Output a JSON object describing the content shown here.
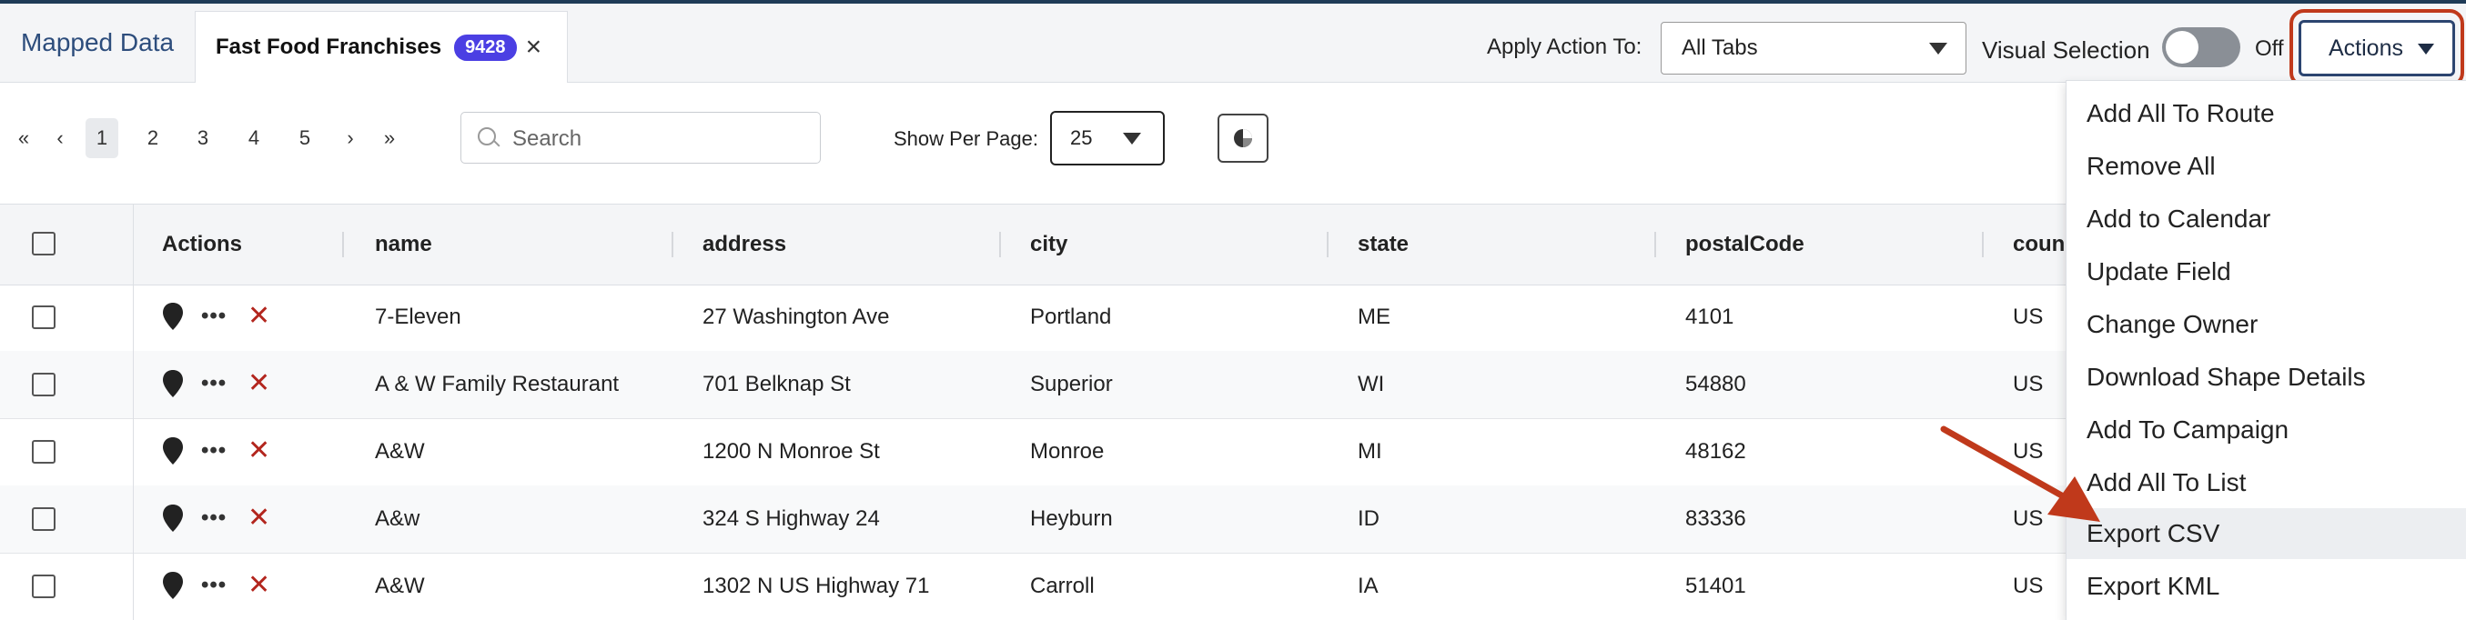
{
  "tabs": {
    "mapped_label": "Mapped Data",
    "active": {
      "label": "Fast Food Franchises",
      "count": "9428",
      "close": "×"
    }
  },
  "controls": {
    "apply_label": "Apply Action To:",
    "apply_value": "All Tabs",
    "visual_label": "Visual Selection",
    "toggle_state": "Off",
    "actions_label": "Actions"
  },
  "pager": {
    "first": "«",
    "prev": "‹",
    "pages": [
      "1",
      "2",
      "3",
      "4",
      "5"
    ],
    "next": "›",
    "last": "»",
    "active_page": "1"
  },
  "search": {
    "placeholder": "Search"
  },
  "perpage": {
    "label": "Show Per Page:",
    "value": "25"
  },
  "table": {
    "headers": [
      "Actions",
      "name",
      "address",
      "city",
      "state",
      "postalCode",
      "coun"
    ],
    "rows": [
      {
        "name": "7-Eleven",
        "address": "27 Washington Ave",
        "city": "Portland",
        "state": "ME",
        "postalCode": "4101",
        "country": "US"
      },
      {
        "name": "A & W Family Restaurant",
        "address": "701 Belknap St",
        "city": "Superior",
        "state": "WI",
        "postalCode": "54880",
        "country": "US"
      },
      {
        "name": "A&W",
        "address": "1200 N Monroe St",
        "city": "Monroe",
        "state": "MI",
        "postalCode": "48162",
        "country": "US"
      },
      {
        "name": "A&w",
        "address": "324 S Highway 24",
        "city": "Heyburn",
        "state": "ID",
        "postalCode": "83336",
        "country": "US"
      },
      {
        "name": "A&W",
        "address": "1302 N US Highway 71",
        "city": "Carroll",
        "state": "IA",
        "postalCode": "51401",
        "country": "US"
      }
    ],
    "row_icons": {
      "pin": "map-pin-icon",
      "more": "•••",
      "delete": "✕"
    }
  },
  "menu": {
    "items": [
      "Add All To Route",
      "Remove All",
      "Add to Calendar",
      "Update Field",
      "Change Owner",
      "Download Shape Details",
      "Add To Campaign",
      "Add All To List",
      "Export CSV",
      "Export KML"
    ],
    "highlighted": "Export CSV"
  },
  "colors": {
    "badge": "#4b3fe3",
    "highlight_ring": "#c0391b",
    "delete_x": "#b3261e",
    "nav_text": "#2d4d7c"
  }
}
